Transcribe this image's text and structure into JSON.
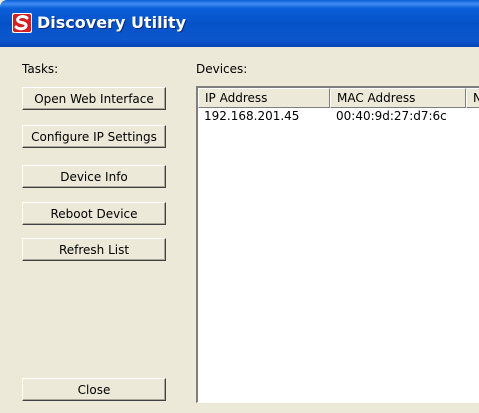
{
  "window": {
    "title": "Discovery Utility",
    "icon": "app-logo-icon",
    "titlebar_color": "#0a5fd8"
  },
  "tasks": {
    "label": "Tasks:",
    "buttons": [
      {
        "label": "Open Web Interface"
      },
      {
        "label": "Configure IP Settings"
      },
      {
        "label": "Device Info"
      },
      {
        "label": "Reboot Device"
      },
      {
        "label": "Refresh List"
      }
    ],
    "close_label": "Close"
  },
  "devices": {
    "label": "Devices:",
    "columns": [
      "IP Address",
      "MAC Address",
      "N"
    ],
    "rows": [
      {
        "ip": "192.168.201.45",
        "mac": "00:40:9d:27:d7:6c"
      }
    ]
  }
}
